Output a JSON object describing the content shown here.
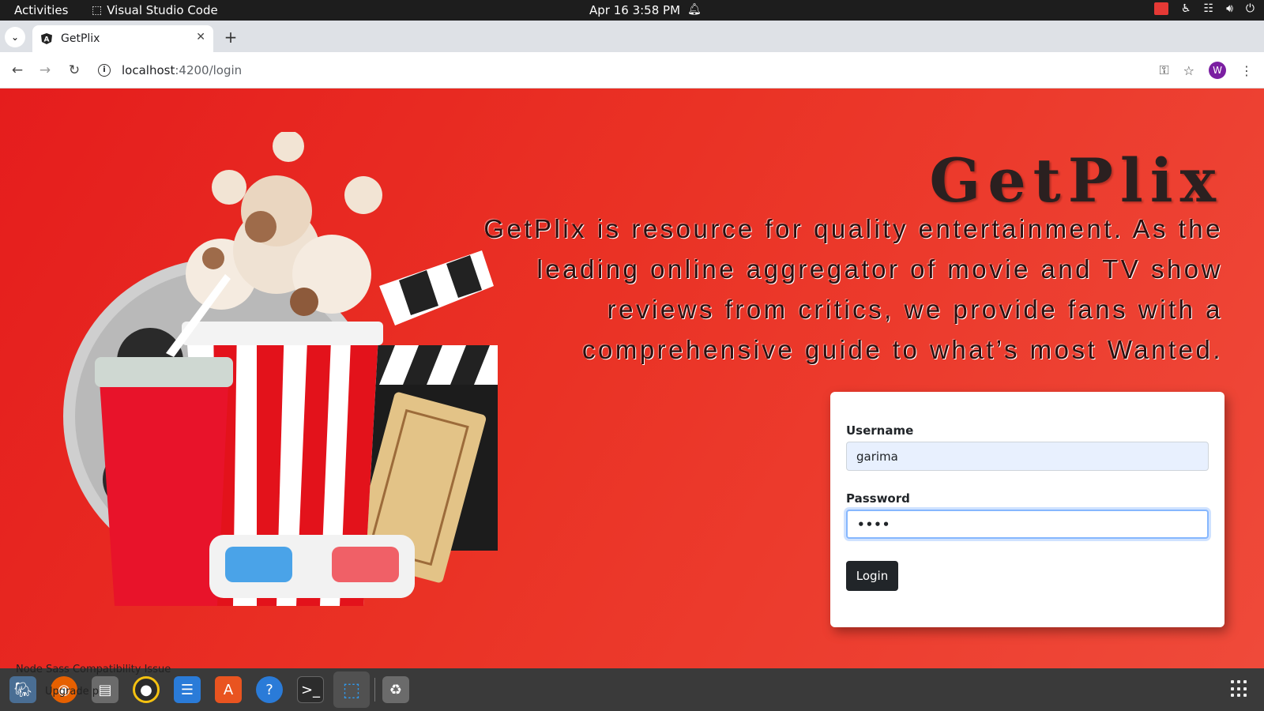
{
  "system": {
    "activities": "Activities",
    "app_name": "Visual Studio Code",
    "clock": "Apr 16  3:58 PM"
  },
  "browser": {
    "tab_title": "GetPlix",
    "url_host": "localhost",
    "url_path": ":4200/login",
    "profile_initial": "W"
  },
  "page": {
    "brand": "GetPlix",
    "tagline": "GetPlix is resource for quality entertainment. As the leading online aggregator of movie and TV show reviews from critics, we provide fans with a comprehensive guide to what’s most Wanted.",
    "form": {
      "username_label": "Username",
      "username_value": "garima",
      "password_label": "Password",
      "password_value": "••••",
      "login_label": "Login"
    }
  },
  "taskbar": {
    "notice": "Node Sass Compatibility Issue",
    "notice2": "Upgrade p"
  },
  "colors": {
    "page_background": "#e8261f",
    "card_background": "#ffffff",
    "button_background": "#212529",
    "username_fill": "#e8f0fe",
    "focus_ring": "#86b7fe"
  },
  "icons": [
    "angular-icon",
    "info-icon",
    "key-icon",
    "star-icon",
    "menu-dots-icon",
    "bell-icon",
    "accessibility-icon",
    "network-icon",
    "volume-icon",
    "power-icon",
    "vscode-icon"
  ]
}
